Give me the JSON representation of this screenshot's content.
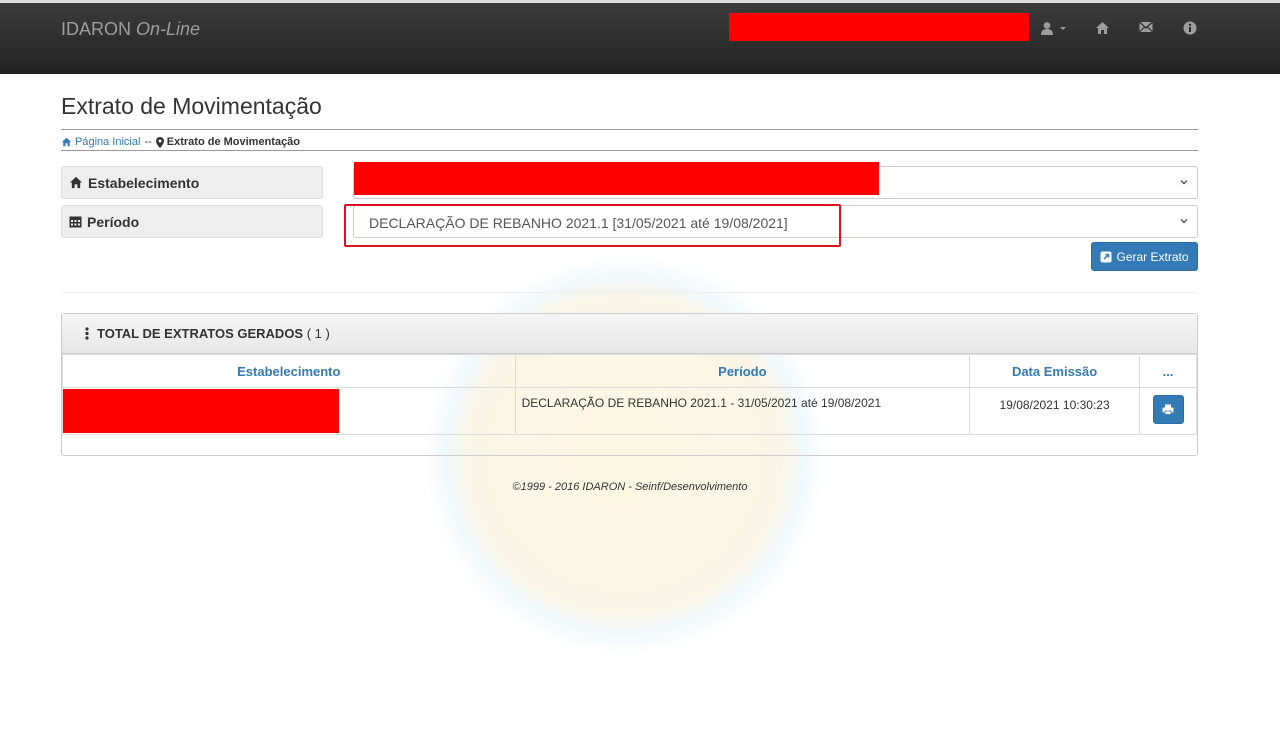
{
  "navbar": {
    "brand_main": "IDARON",
    "brand_italic": "On-Line",
    "icons": [
      "user-icon",
      "caret-down-icon",
      "home-icon",
      "envelope-icon",
      "info-icon"
    ]
  },
  "page": {
    "title": "Extrato de Movimentação"
  },
  "breadcrumb": {
    "home_label": "Página Inicial",
    "separator": "--",
    "current_label": "Extrato de Movimentação"
  },
  "form": {
    "estabelecimento_label": "Estabelecimento",
    "periodo_label": "Período",
    "periodo_value": "DECLARAÇÃO DE REBANHO 2021.1 [31/05/2021 até 19/08/2021]",
    "gerar_label": "Gerar Extrato"
  },
  "panel": {
    "title": "TOTAL DE EXTRATOS GERADOS",
    "count": "( 1 )",
    "columns": [
      "Estabelecimento",
      "Período",
      "Data Emissão",
      "..."
    ],
    "rows": [
      {
        "periodo": "DECLARAÇÃO DE REBANHO 2021.1 - 31/05/2021 até 19/08/2021",
        "data_emissao": "19/08/2021 10:30:23"
      }
    ]
  },
  "footer": {
    "text": "©1999 - 2016 IDARON - Seinf/Desenvolvimento"
  },
  "colors": {
    "navbar_bg": "#2a2a2a",
    "primary": "#337ab7",
    "redaction": "#ff0000",
    "highlight": "#d9131f"
  }
}
